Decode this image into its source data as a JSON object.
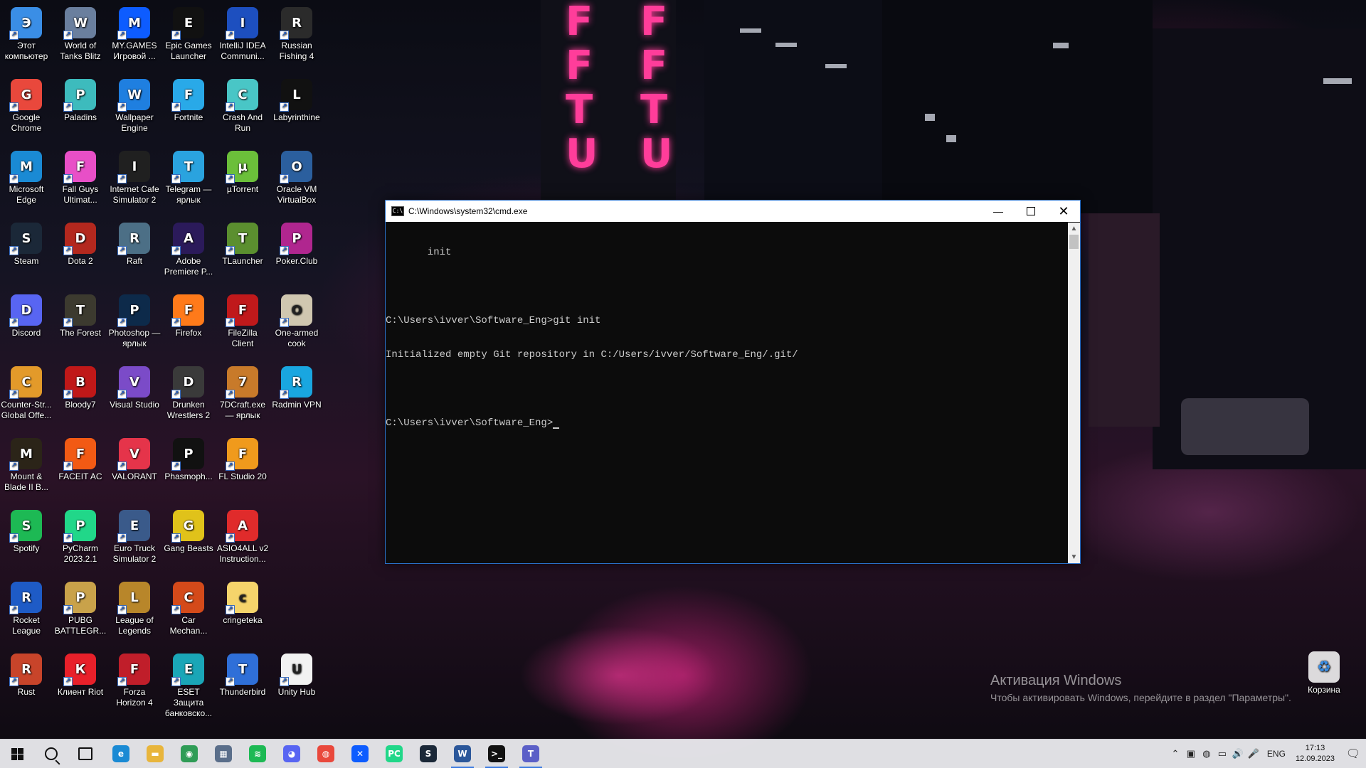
{
  "desktop": {
    "icons": [
      {
        "label": "Этот компьютер",
        "icon": "this-pc-icon",
        "color": "#3a8ee6"
      },
      {
        "label": "World of Tanks Blitz",
        "icon": "world-of-tanks-blitz-icon",
        "color": "#6a7f9e"
      },
      {
        "label": "MY.GAMES Игровой ...",
        "icon": "my-games-icon",
        "color": "#0d5cff"
      },
      {
        "label": "Epic Games Launcher",
        "icon": "epic-games-icon",
        "color": "#111111"
      },
      {
        "label": "IntelliJ IDEA Communi...",
        "icon": "intellij-idea-icon",
        "color": "#1d4fbf"
      },
      {
        "label": "Russian Fishing 4",
        "icon": "russian-fishing-icon",
        "color": "#2b2b2b"
      },
      {
        "label": "Google Chrome",
        "icon": "chrome-icon",
        "color": "#e9483c"
      },
      {
        "label": "Paladins",
        "icon": "paladins-icon",
        "color": "#3dbbbd"
      },
      {
        "label": "Wallpaper Engine",
        "icon": "wallpaper-engine-icon",
        "color": "#1f7fe0"
      },
      {
        "label": "Fortnite",
        "icon": "fortnite-icon",
        "color": "#29a9e8"
      },
      {
        "label": "Crash And Run",
        "icon": "crash-and-run-icon",
        "color": "#49c6c6"
      },
      {
        "label": "Labyrinthine",
        "icon": "labyrinthine-icon",
        "color": "#111111"
      },
      {
        "label": "Microsoft Edge",
        "icon": "edge-icon",
        "color": "#1a8ad4"
      },
      {
        "label": "Fall Guys Ultimat...",
        "icon": "fall-guys-icon",
        "color": "#e84fc7"
      },
      {
        "label": "Internet Cafe Simulator 2",
        "icon": "internet-cafe-icon",
        "color": "#202020"
      },
      {
        "label": "Telegram — ярлык",
        "icon": "telegram-icon",
        "color": "#2aa3df"
      },
      {
        "label": "µTorrent",
        "icon": "utorrent-icon",
        "color": "#6bbf3a"
      },
      {
        "label": "Oracle VM VirtualBox",
        "icon": "virtualbox-icon",
        "color": "#2b5f9e"
      },
      {
        "label": "Steam",
        "icon": "steam-icon",
        "color": "#1b2838"
      },
      {
        "label": "Dota 2",
        "icon": "dota2-icon",
        "color": "#b3281e"
      },
      {
        "label": "Raft",
        "icon": "raft-icon",
        "color": "#4c6f86"
      },
      {
        "label": "Adobe Premiere P...",
        "icon": "premiere-icon",
        "color": "#2b1a5a"
      },
      {
        "label": "TLauncher",
        "icon": "tlauncher-icon",
        "color": "#5b8f2f"
      },
      {
        "label": "Poker.Club",
        "icon": "poker-club-icon",
        "color": "#b0268f"
      },
      {
        "label": "Discord",
        "icon": "discord-icon",
        "color": "#5865f2"
      },
      {
        "label": "The Forest",
        "icon": "the-forest-icon",
        "color": "#3c3a2f"
      },
      {
        "label": "Photoshop — ярлык",
        "icon": "photoshop-icon",
        "color": "#0d2a4a"
      },
      {
        "label": "Firefox",
        "icon": "firefox-icon",
        "color": "#ff7a1a"
      },
      {
        "label": "FileZilla Client",
        "icon": "filezilla-icon",
        "color": "#c0191b"
      },
      {
        "label": "One-armed cook",
        "icon": "one-armed-cook-icon",
        "color": "#d0c7b0"
      },
      {
        "label": "Counter-Str... Global Offe...",
        "icon": "csgo-icon",
        "color": "#e39a2a"
      },
      {
        "label": "Bloody7",
        "icon": "bloody7-icon",
        "color": "#c01818"
      },
      {
        "label": "Visual Studio",
        "icon": "visual-studio-icon",
        "color": "#7b4bc8"
      },
      {
        "label": "Drunken Wrestlers 2",
        "icon": "drunken-wrestlers-icon",
        "color": "#3a3a3a"
      },
      {
        "label": "7DCraft.exe — ярлык",
        "icon": "7dcraft-icon",
        "color": "#c87a2a"
      },
      {
        "label": "Radmin VPN",
        "icon": "radmin-vpn-icon",
        "color": "#19a6e0"
      },
      {
        "label": "Mount & Blade II B...",
        "icon": "mount-blade-icon",
        "color": "#2b2418"
      },
      {
        "label": "FACEIT AC",
        "icon": "faceit-icon",
        "color": "#f25a14"
      },
      {
        "label": "VALORANT",
        "icon": "valorant-icon",
        "color": "#e5344a"
      },
      {
        "label": "Phasmoph...",
        "icon": "phasmophobia-icon",
        "color": "#111111"
      },
      {
        "label": "FL Studio 20",
        "icon": "fl-studio-icon",
        "color": "#f09a1c"
      },
      {
        "label": "Spotify",
        "icon": "spotify-icon",
        "color": "#1db954"
      },
      {
        "label": "PyCharm 2023.2.1",
        "icon": "pycharm-icon",
        "color": "#21d789"
      },
      {
        "label": "Euro Truck Simulator 2",
        "icon": "euro-truck-icon",
        "color": "#3a5a8a"
      },
      {
        "label": "Gang Beasts",
        "icon": "gang-beasts-icon",
        "color": "#e0c21a"
      },
      {
        "label": "ASIO4ALL v2 Instruction...",
        "icon": "pdf-icon",
        "color": "#e02b2b"
      },
      {
        "label": "Rocket League",
        "icon": "rocket-league-icon",
        "color": "#1e5bc6"
      },
      {
        "label": "PUBG BATTLEGR...",
        "icon": "pubg-icon",
        "color": "#c9a24a"
      },
      {
        "label": "League of Legends",
        "icon": "league-of-legends-icon",
        "color": "#b8862a"
      },
      {
        "label": "Car Mechan...",
        "icon": "car-mechanic-icon",
        "color": "#d44a1a"
      },
      {
        "label": "cringeteka",
        "icon": "folder-icon",
        "color": "#f5d46b"
      },
      {
        "label": "Rust",
        "icon": "rust-icon",
        "color": "#c8442a"
      },
      {
        "label": "Клиент Riot",
        "icon": "riot-client-icon",
        "color": "#e8202a"
      },
      {
        "label": "Forza Horizon 4",
        "icon": "forza-horizon-icon",
        "color": "#c01e2a"
      },
      {
        "label": "ESET Защита банковско...",
        "icon": "eset-icon",
        "color": "#1aa6b7"
      },
      {
        "label": "Thunderbird",
        "icon": "thunderbird-icon",
        "color": "#2f6fd8"
      },
      {
        "label": "Unity Hub",
        "icon": "unity-hub-icon",
        "color": "#f2f2f2"
      }
    ],
    "recycle_bin": {
      "label": "Корзина",
      "icon": "recycle-bin-icon"
    }
  },
  "cmd_window": {
    "title": "C:\\Windows\\system32\\cmd.exe",
    "lines": [
      "       init",
      "",
      "C:\\Users\\ivver\\Software_Eng>git init",
      "Initialized empty Git repository in C:/Users/ivver/Software_Eng/.git/",
      "",
      "C:\\Users\\ivver\\Software_Eng>"
    ]
  },
  "watermark": {
    "title": "Активация Windows",
    "subtitle": "Чтобы активировать Windows, перейдите в раздел \"Параметры\"."
  },
  "taskbar": {
    "apps": [
      {
        "name": "edge",
        "icon": "edge-icon",
        "color": "#1a8ad4",
        "glyph": "e",
        "active": false
      },
      {
        "name": "file-explorer",
        "icon": "folder-icon",
        "color": "#e8b53c",
        "glyph": "▬",
        "active": false
      },
      {
        "name": "android-app",
        "icon": "android-icon",
        "color": "#2f9c56",
        "glyph": "◉",
        "active": false
      },
      {
        "name": "calculator",
        "icon": "calculator-icon",
        "color": "#5a6e8a",
        "glyph": "▦",
        "active": false
      },
      {
        "name": "spotify",
        "icon": "spotify-icon",
        "color": "#1db954",
        "glyph": "≋",
        "active": false
      },
      {
        "name": "discord",
        "icon": "discord-icon",
        "color": "#5865f2",
        "glyph": "◕",
        "active": false
      },
      {
        "name": "chrome",
        "icon": "chrome-icon",
        "color": "#e9483c",
        "glyph": "◍",
        "active": false
      },
      {
        "name": "my-games",
        "icon": "my-games-icon",
        "color": "#0d5cff",
        "glyph": "✕",
        "active": false
      },
      {
        "name": "pycharm",
        "icon": "pycharm-icon",
        "color": "#21d789",
        "glyph": "PC",
        "active": false
      },
      {
        "name": "steam",
        "icon": "steam-icon",
        "color": "#1b2838",
        "glyph": "S",
        "active": false
      },
      {
        "name": "word",
        "icon": "word-icon",
        "color": "#2b579a",
        "glyph": "W",
        "active": true
      },
      {
        "name": "cmd",
        "icon": "terminal-icon",
        "color": "#111111",
        "glyph": ">_",
        "active": true
      },
      {
        "name": "teams",
        "icon": "teams-icon",
        "color": "#5b5fc7",
        "glyph": "T",
        "active": true
      }
    ],
    "language": "ENG",
    "time": "17:13",
    "date": "12.09.2023"
  }
}
